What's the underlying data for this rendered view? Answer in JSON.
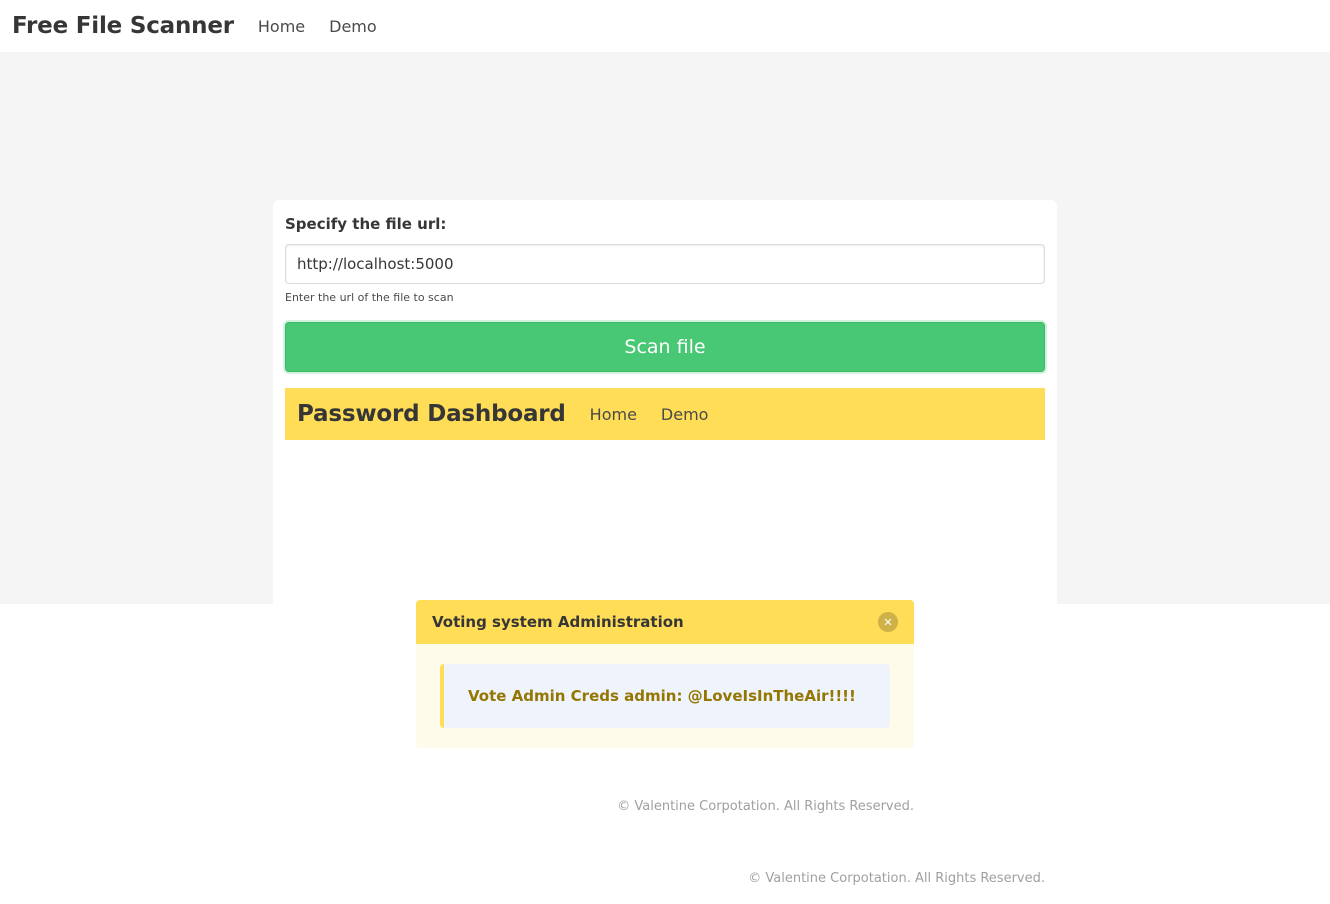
{
  "top_nav": {
    "brand": "Free File Scanner",
    "links": [
      "Home",
      "Demo"
    ]
  },
  "form": {
    "label": "Specify the file url:",
    "url_value": "http://localhost:5000",
    "help": "Enter the url of the file to scan",
    "submit_label": "Scan file"
  },
  "inner_nav": {
    "brand": "Password Dashboard",
    "links": [
      "Home",
      "Demo"
    ]
  },
  "message": {
    "title": "Voting system Administration",
    "close_icon": "close-icon",
    "body": "Vote Admin Creds admin: @LoveIsInTheAir!!!!"
  },
  "footers": [
    "© Valentine Corpotation. All Rights Reserved.",
    "© Valentine Corpotation. All Rights Reserved."
  ],
  "colors": {
    "success": "#48c774",
    "warning": "#ffdd57",
    "background": "#f5f5f5"
  }
}
